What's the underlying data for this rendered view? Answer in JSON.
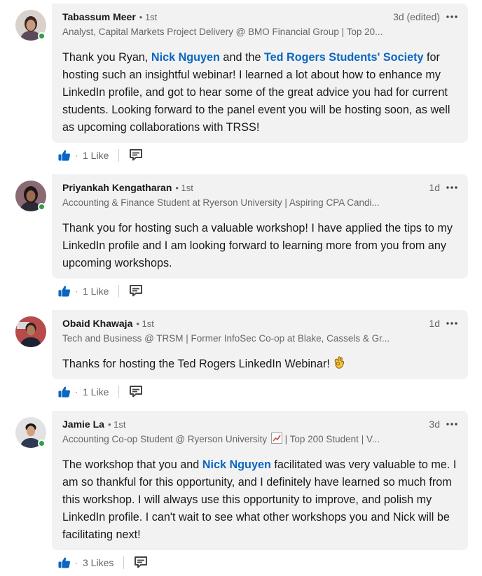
{
  "colors": {
    "mention": "#0a66c2",
    "bubble": "#f2f2f2",
    "presence": "#2f9d44"
  },
  "comments": [
    {
      "name": "Tabassum Meer",
      "degree": "• 1st",
      "time": "3d (edited)",
      "headline": "Analyst, Capital Markets Project Delivery @ BMO Financial Group | Top 20...",
      "body_pre": "Thank you Ryan, ",
      "mention1": "Nick Nguyen",
      "body_mid": " and the ",
      "mention2": "Ted Rogers Students' Society",
      "body_post": " for hosting such an insightful webinar! I learned a lot about how to enhance my LinkedIn profile, and got to hear some of the great advice you had for current students. Looking forward to the panel event you will be hosting soon, as well as upcoming collaborations with TRSS!",
      "dot": "·",
      "likes": "1 Like"
    },
    {
      "name": "Priyankah Kengatharan",
      "degree": "• 1st",
      "time": "1d",
      "headline": "Accounting & Finance Student at Ryerson University | Aspiring CPA Candi...",
      "body": "Thank you for hosting such a valuable workshop! I have applied the tips to my LinkedIn profile and I am looking forward to learning more from you from any upcoming workshops.",
      "dot": "·",
      "likes": "1 Like"
    },
    {
      "name": "Obaid Khawaja",
      "degree": "• 1st",
      "time": "1d",
      "headline": "Tech and Business @ TRSM | Former InfoSec Co-op at Blake, Cassels & Gr...",
      "body": "Thanks for hosting the Ted Rogers LinkedIn Webinar! ",
      "emoji": "ok-hand-emoji",
      "dot": "·",
      "likes": "1 Like"
    },
    {
      "name": "Jamie La",
      "degree": "• 1st",
      "time": "3d",
      "headline_pre": "Accounting Co-op Student @ Ryerson University ",
      "headline_icon": "chart-increasing-emoji",
      "headline_post": " | Top 200 Student | V...",
      "body_pre": "The workshop that you and ",
      "mention1": "Nick Nguyen",
      "body_post": " facilitated was very valuable to me. I am so thankful for this opportunity, and I definitely have learned so much from this workshop. I will always use this opportunity to improve, and polish my LinkedIn profile. I can't wait to see what other workshops you and Nick will be facilitating next!",
      "dot": "·",
      "likes": "3 Likes"
    }
  ]
}
